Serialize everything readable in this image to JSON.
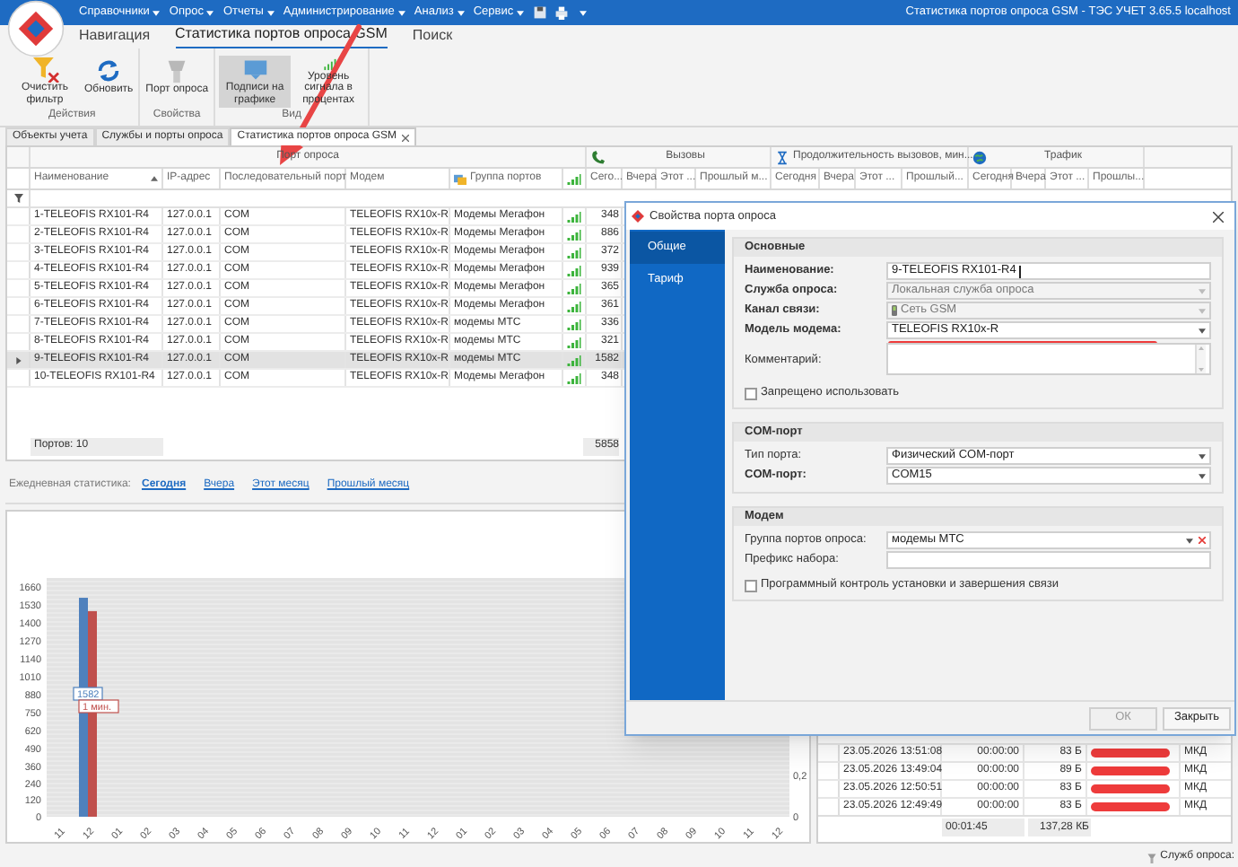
{
  "window": {
    "title": "Статистика портов опроса GSM - ТЭС УЧЕТ 3.65.5 localhost"
  },
  "menu": [
    "Справочники",
    "Опрос",
    "Отчеты",
    "Администрирование",
    "Анализ",
    "Сервис"
  ],
  "ribbon_tabs": [
    {
      "label": "Навигация",
      "selected": false
    },
    {
      "label": "Статистика портов опроса GSM",
      "selected": true
    },
    {
      "label": "Поиск",
      "selected": false
    }
  ],
  "ribbon_groups": [
    {
      "title": "Действия",
      "buttons": [
        {
          "label": "Очистить фильтр",
          "kind": "clear-filter",
          "selected": false
        },
        {
          "label": "Обновить",
          "kind": "refresh",
          "selected": false
        }
      ]
    },
    {
      "title": "Свойства",
      "buttons": [
        {
          "label": "Порт опроса",
          "kind": "port",
          "selected": false
        }
      ]
    },
    {
      "title": "Вид",
      "buttons": [
        {
          "label": "Подписи на графике",
          "kind": "captions",
          "selected": true
        },
        {
          "label": "Уровень сигнала в процентах",
          "kind": "signal",
          "selected": false
        }
      ]
    }
  ],
  "doc_tabs": [
    {
      "label": "Объекты учета",
      "selected": false,
      "closable": false
    },
    {
      "label": "Службы и порты опроса",
      "selected": false,
      "closable": false
    },
    {
      "label": "Статистика портов опроса GSM",
      "selected": true,
      "closable": true
    }
  ],
  "grid": {
    "bands": [
      {
        "label": "Порт опроса",
        "kind": "plain",
        "columns": [
          {
            "label": "Наименование",
            "kind": "sorted"
          },
          {
            "label": "IP-адрес",
            "kind": "text"
          },
          {
            "label": "Последовательный порт",
            "kind": "text"
          },
          {
            "label": "Модем",
            "kind": "text"
          },
          {
            "label": "Группа портов",
            "kind": "group"
          },
          {
            "kind": "signal"
          }
        ]
      },
      {
        "label": "Вызовы",
        "kind": "calls",
        "columns": [
          {
            "label": "Сего...",
            "kind": "text"
          },
          {
            "label": "Вчера",
            "kind": "text"
          },
          {
            "label": "Этот ...",
            "kind": "text"
          },
          {
            "label": "Прошлый м...",
            "kind": "text"
          }
        ]
      },
      {
        "label": "Продолжительность вызовов, мин...",
        "kind": "duration",
        "columns": [
          {
            "label": "Сегодня",
            "kind": "text"
          },
          {
            "label": "Вчера",
            "kind": "text"
          },
          {
            "label": "Этот ...",
            "kind": "text"
          },
          {
            "label": "Прошлый...",
            "kind": "text"
          }
        ]
      },
      {
        "label": "Трафик",
        "kind": "traffic",
        "columns": [
          {
            "label": "Сегодня",
            "kind": "text"
          },
          {
            "label": "Вчера",
            "kind": "text"
          },
          {
            "label": "Этот ...",
            "kind": "text"
          },
          {
            "label": "Прошлы...",
            "kind": "text"
          }
        ]
      }
    ],
    "rows": [
      {
        "name": "1-TELEOFIS RX101-R4",
        "ip": "127.0.0.1",
        "port": "COM",
        "modem": "TELEOFIS RX10x-R",
        "group": "Модемы Мегафон",
        "calls_today": "348",
        "selected": false
      },
      {
        "name": "2-TELEOFIS RX101-R4",
        "ip": "127.0.0.1",
        "port": "COM",
        "modem": "TELEOFIS RX10x-R",
        "group": "Модемы Мегафон",
        "calls_today": "886",
        "selected": false
      },
      {
        "name": "3-TELEOFIS RX101-R4",
        "ip": "127.0.0.1",
        "port": "COM",
        "modem": "TELEOFIS RX10x-R",
        "group": "Модемы Мегафон",
        "calls_today": "372",
        "selected": false
      },
      {
        "name": "4-TELEOFIS RX101-R4",
        "ip": "127.0.0.1",
        "port": "COM",
        "modem": "TELEOFIS RX10x-R",
        "group": "Модемы Мегафон",
        "calls_today": "939",
        "selected": false
      },
      {
        "name": "5-TELEOFIS RX101-R4",
        "ip": "127.0.0.1",
        "port": "COM",
        "modem": "TELEOFIS RX10x-R",
        "group": "Модемы Мегафон",
        "calls_today": "365",
        "selected": false
      },
      {
        "name": "6-TELEOFIS RX101-R4",
        "ip": "127.0.0.1",
        "port": "COM",
        "modem": "TELEOFIS RX10x-R",
        "group": "Модемы Мегафон",
        "calls_today": "361",
        "selected": false
      },
      {
        "name": "7-TELEOFIS RX101-R4",
        "ip": "127.0.0.1",
        "port": "COM",
        "modem": "TELEOFIS RX10x-R",
        "group": "модемы МТС",
        "calls_today": "336",
        "selected": false
      },
      {
        "name": "8-TELEOFIS RX101-R4",
        "ip": "127.0.0.1",
        "port": "COM",
        "modem": "TELEOFIS RX10x-R",
        "group": "модемы МТС",
        "calls_today": "321",
        "selected": false
      },
      {
        "name": "9-TELEOFIS RX101-R4",
        "ip": "127.0.0.1",
        "port": "COM",
        "modem": "TELEOFIS RX10x-R",
        "group": "модемы МТС",
        "calls_today": "1582",
        "selected": true
      },
      {
        "name": "10-TELEOFIS RX101-R4",
        "ip": "127.0.0.1",
        "port": "COM",
        "modem": "TELEOFIS RX10x-R",
        "group": "Модемы Мегафон",
        "calls_today": "348",
        "selected": false
      }
    ],
    "footer_count": "Портов: 10",
    "footer_calls": "5858"
  },
  "daily_stats": {
    "label": "Ежедневная статистика:",
    "links": [
      {
        "label": "Сегодня",
        "selected": true
      },
      {
        "label": "Вчера",
        "selected": false
      },
      {
        "label": "Этот месяц",
        "selected": false
      },
      {
        "label": "Прошлый месяц",
        "selected": false
      }
    ]
  },
  "chart": {
    "chart_data": {
      "type": "bar",
      "categories": [
        "11",
        "12",
        "01",
        "02",
        "03",
        "04",
        "05",
        "06",
        "07",
        "08",
        "09",
        "10",
        "11",
        "12",
        "01",
        "02",
        "03",
        "04",
        "05",
        "06",
        "07",
        "08",
        "09",
        "10",
        "11",
        "12"
      ],
      "series": [
        {
          "color": "#4f81bd",
          "values": [
            null,
            1582,
            null,
            null,
            null,
            null,
            null,
            null,
            null,
            null,
            null,
            null,
            null,
            null,
            null,
            null,
            null,
            null,
            null,
            null,
            null,
            null,
            null,
            null,
            null,
            null
          ],
          "value_labels": [
            null,
            "1582",
            null,
            null,
            null,
            null,
            null,
            null,
            null,
            null,
            null,
            null,
            null,
            null,
            null,
            null,
            null,
            null,
            null,
            null,
            null,
            null,
            null,
            null,
            null,
            null
          ]
        },
        {
          "color": "#c0504d",
          "axis": "y2",
          "values": [
            null,
            1,
            null,
            null,
            null,
            null,
            null,
            null,
            null,
            null,
            null,
            null,
            null,
            null,
            null,
            null,
            null,
            null,
            null,
            null,
            null,
            null,
            null,
            null,
            null,
            null
          ],
          "value_labels": [
            null,
            "1 мин.",
            null,
            null,
            null,
            null,
            null,
            null,
            null,
            null,
            null,
            null,
            null,
            null,
            null,
            null,
            null,
            null,
            null,
            null,
            null,
            null,
            null,
            null,
            null,
            null
          ]
        }
      ],
      "grid": true,
      "ylim": [
        0,
        1660
      ],
      "y2lim": [
        0,
        1.1
      ],
      "yticks": [
        0,
        120,
        240,
        360,
        490,
        620,
        750,
        880,
        1010,
        1140,
        1270,
        1400,
        1530,
        1660
      ],
      "y2ticks": [
        {
          "value": 0,
          "label": "0"
        },
        {
          "value": 0.2,
          "label": "0,2"
        }
      ]
    }
  },
  "log": {
    "rows": [
      {
        "time": "23.05.2026 13:51:08",
        "duration": "00:00:00",
        "size": "83 Б",
        "redacted": true,
        "type": "МКД"
      },
      {
        "time": "23.05.2026 13:49:04",
        "duration": "00:00:00",
        "size": "89 Б",
        "redacted": true,
        "type": "МКД"
      },
      {
        "time": "23.05.2026 12:50:51",
        "duration": "00:00:00",
        "size": "83 Б",
        "redacted": true,
        "type": "МКД"
      },
      {
        "time": "23.05.2026 12:49:49",
        "duration": "00:00:00",
        "size": "83 Б",
        "redacted": true,
        "type": "МКД"
      }
    ],
    "duration_total": "00:01:45",
    "size_total": "137,28 КБ"
  },
  "status_bar": {
    "text": "Служб опроса:"
  },
  "dialog": {
    "title": "Свойства порта опроса",
    "nav": [
      {
        "label": "Общие",
        "selected": true
      },
      {
        "label": "Тариф",
        "selected": false
      }
    ],
    "groups": [
      {
        "title": "Основные",
        "fields": [
          {
            "label": "Наименование:",
            "kind": "text",
            "value": "9-TELEOFIS RX101-R4",
            "required": true,
            "disabled": false,
            "redacted": false
          },
          {
            "label": "Служба опроса:",
            "kind": "dropdown",
            "value": "Локальная служба опроса",
            "required": true,
            "disabled": true,
            "redacted": false
          },
          {
            "label": "Канал связи:",
            "kind": "channel",
            "value": "Сеть GSM",
            "required": true,
            "disabled": true,
            "redacted": false
          },
          {
            "label": "Модель модема:",
            "kind": "dropdown",
            "value": "TELEOFIS RX10x-R",
            "required": true,
            "disabled": false,
            "redacted": true
          },
          {
            "label": "Комментарий:",
            "kind": "textarea",
            "required": false,
            "disabled": false,
            "redacted": false
          }
        ],
        "checkboxes": [
          {
            "label": "Запрещено использовать",
            "checked": false
          }
        ]
      },
      {
        "title": "COM-порт",
        "fields": [
          {
            "label": "Тип порта:",
            "kind": "dropdown",
            "value": "Физический COM-порт",
            "required": false,
            "disabled": false
          },
          {
            "label": "COM-порт:",
            "kind": "dropdown",
            "value": "COM15",
            "required": true,
            "disabled": false
          }
        ]
      },
      {
        "title": "Модем",
        "fields": [
          {
            "label": "Группа портов опроса:",
            "kind": "clearable",
            "value": "модемы МТС",
            "required": false,
            "disabled": false
          },
          {
            "label": "Префикс набора:",
            "kind": "text",
            "required": false,
            "disabled": false
          }
        ],
        "checkboxes": [
          {
            "label": "Программный контроль установки и завершения связи",
            "checked": false
          }
        ]
      }
    ],
    "buttons": [
      {
        "label": "ОК",
        "disabled": true
      },
      {
        "label": "Закрыть",
        "disabled": false
      }
    ]
  },
  "markup": {
    "arrow": true
  }
}
